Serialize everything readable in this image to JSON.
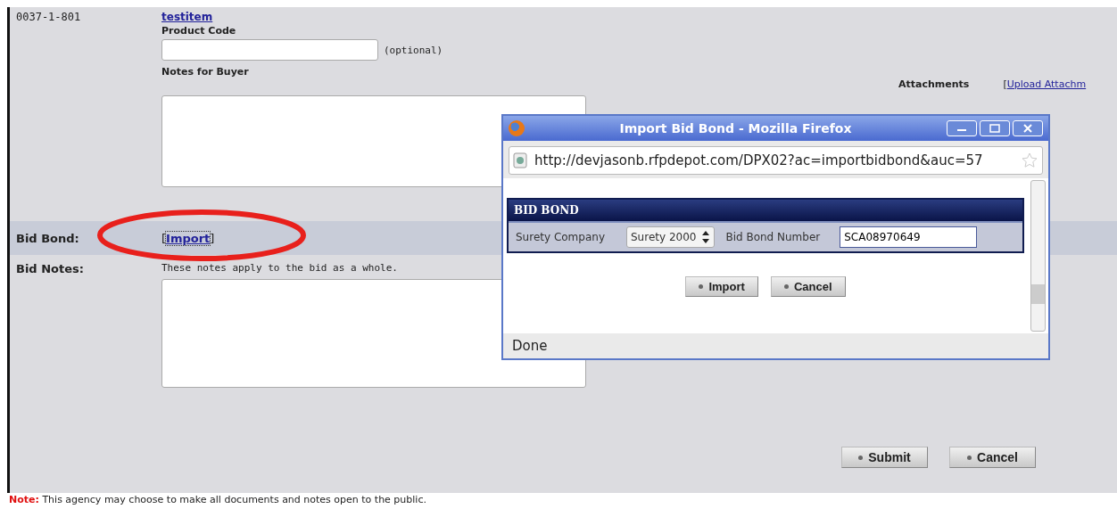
{
  "item": {
    "number": "0037-1-801",
    "name": "testitem",
    "product_code_label": "Product Code",
    "product_code_hint": "(optional)",
    "notes_label": "Notes for Buyer",
    "attachments_label": "Attachments",
    "upload_link": "Upload Attachm",
    "upload_open": "["
  },
  "bid_bond": {
    "label": "Bid Bond:",
    "open": "[",
    "link": "Import",
    "close": "]"
  },
  "bid_notes": {
    "label": "Bid Notes:",
    "hint": "These notes apply to the bid as a whole."
  },
  "buttons": [
    "Submit",
    "Cancel"
  ],
  "note": {
    "prefix": "Note:",
    "text": "This agency may choose to make all documents and notes open to the public."
  },
  "popup": {
    "title": "Import Bid Bond - Mozilla Firefox",
    "url": "http://devjasonb.rfpdepot.com/DPX02?ac=importbidbond&auc=57",
    "panel_title": "BID BOND",
    "surety_label": "Surety Company",
    "surety_value": "Surety 2000",
    "number_label": "Bid Bond Number",
    "number_value": "SCA08970649",
    "buttons": [
      "Import",
      "Cancel"
    ],
    "status": "Done"
  }
}
